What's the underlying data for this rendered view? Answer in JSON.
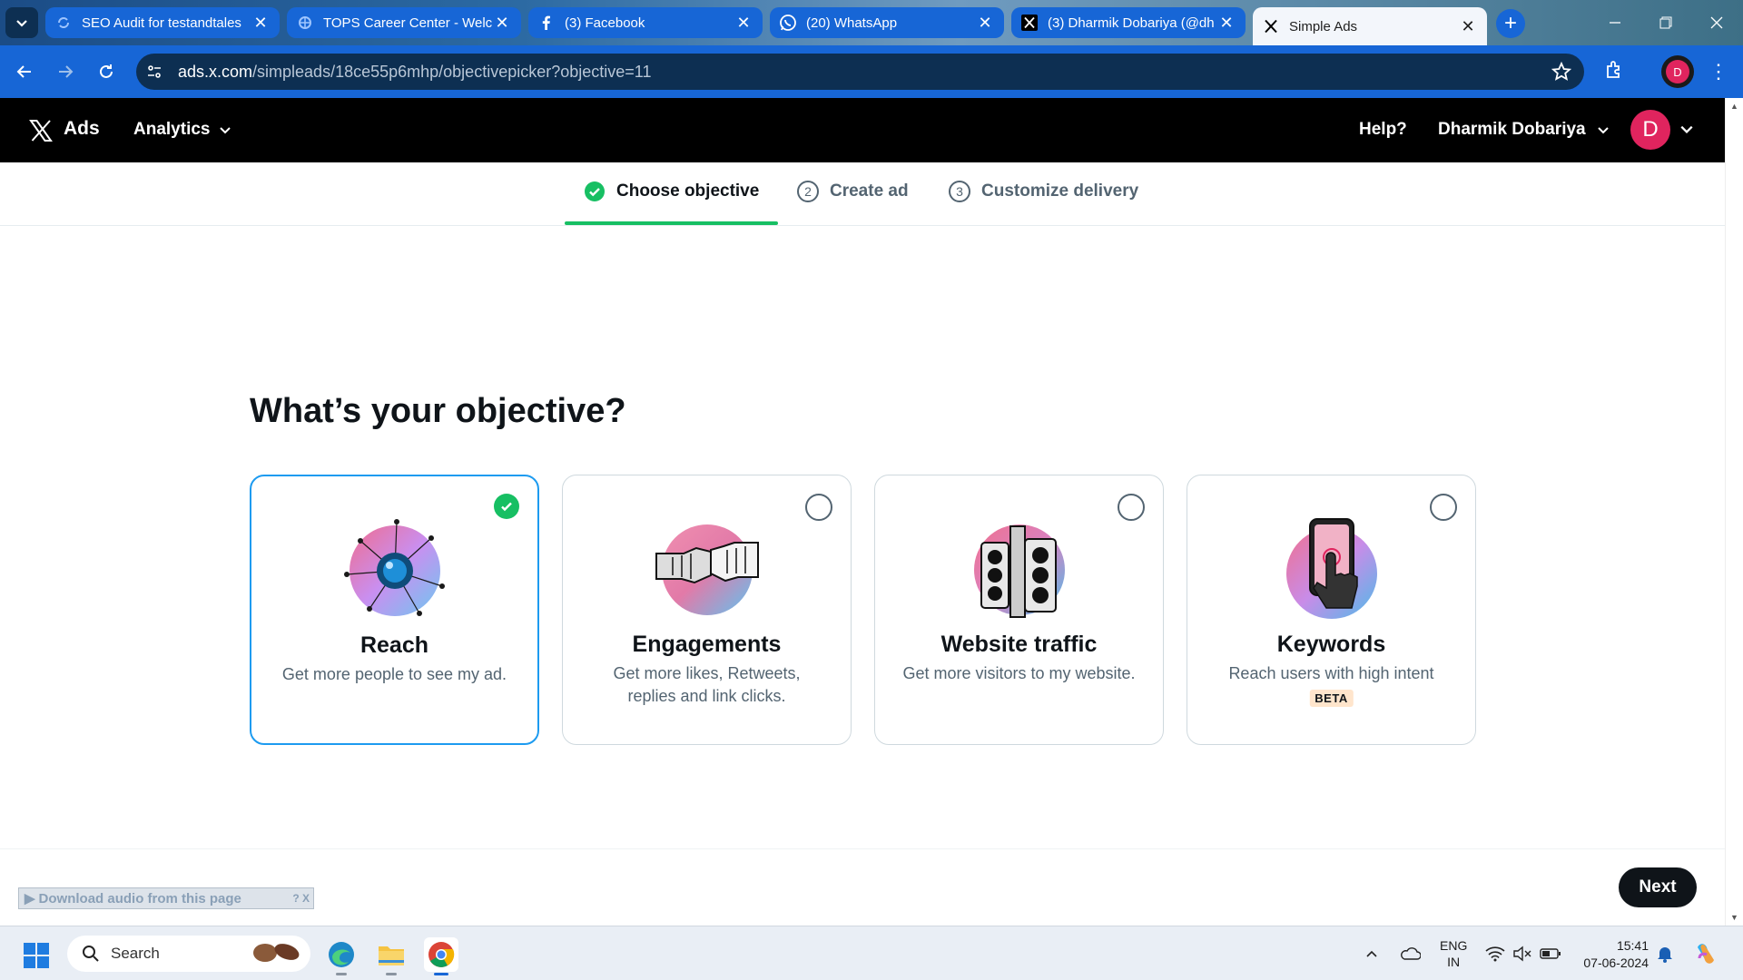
{
  "browser": {
    "tabs": [
      {
        "title": "SEO Audit for testandtales",
        "icon": "seo-audit-icon"
      },
      {
        "title": "TOPS Career Center - Welc",
        "icon": "tops-icon"
      },
      {
        "title": "(3) Facebook",
        "icon": "facebook-icon"
      },
      {
        "title": "(20) WhatsApp",
        "icon": "whatsapp-icon"
      },
      {
        "title": "(3) Dharmik Dobariya (@dh",
        "icon": "x-icon"
      },
      {
        "title": "Simple Ads",
        "icon": "x-icon",
        "active": true
      }
    ],
    "url_host": "ads.x.com",
    "url_path": "/simpleads/18ce55p6mhp/objectivepicker?objective=11",
    "profile_initial": "D"
  },
  "header": {
    "brand": "Ads",
    "analytics": "Analytics",
    "help": "Help?",
    "username": "Dharmik Dobariya",
    "avatar_initial": "D"
  },
  "steps": [
    {
      "label": "Choose objective",
      "state": "done"
    },
    {
      "number": "2",
      "label": "Create ad"
    },
    {
      "number": "3",
      "label": "Customize delivery"
    }
  ],
  "main": {
    "heading": "What’s your objective?",
    "cards": [
      {
        "title": "Reach",
        "desc": "Get more people to see my ad.",
        "selected": true,
        "illustration": "reach-illustration"
      },
      {
        "title": "Engagements",
        "desc": "Get more likes, Retweets, replies and link clicks.",
        "selected": false,
        "illustration": "fist-bump-illustration"
      },
      {
        "title": "Website traffic",
        "desc": "Get more visitors to my website.",
        "selected": false,
        "illustration": "traffic-light-illustration"
      },
      {
        "title": "Keywords",
        "desc": "Reach users with high intent",
        "badge": "BETA",
        "selected": false,
        "illustration": "phone-tap-illustration"
      }
    ],
    "next": "Next"
  },
  "overlay": {
    "download_audio": "Download audio from this page",
    "controls": "?  X"
  },
  "taskbar": {
    "search": "Search",
    "lang_line1": "ENG",
    "lang_line2": "IN",
    "time": "15:41",
    "date": "07-06-2024"
  },
  "colors": {
    "accent_green": "#17bf63",
    "selected_border": "#1d9bf0",
    "browser_blue": "#1766d6",
    "avatar_pink": "#e0245e"
  }
}
